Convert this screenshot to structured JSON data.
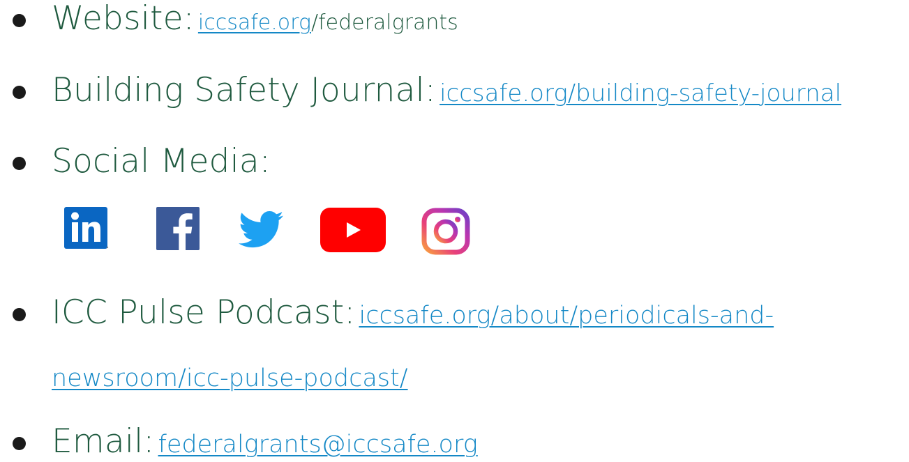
{
  "items": [
    {
      "label": "Website:",
      "link_part": "iccsafe.org",
      "plain_part": "/federalgrants"
    },
    {
      "label": "Building Safety Journal:",
      "link": "iccsafe.org/building-safety-journal"
    },
    {
      "label": "Social Media:"
    },
    {
      "label": "ICC Pulse Podcast:",
      "link_line1": "iccsafe.org/about/periodicals-and-",
      "link_line2": "newsroom/icc-pulse-podcast/"
    },
    {
      "label": "Email:",
      "link": "federalgrants@iccsafe.org"
    }
  ],
  "social_icons": [
    "linkedin-icon",
    "facebook-icon",
    "twitter-icon",
    "youtube-icon",
    "instagram-icon"
  ],
  "colors": {
    "text": "#1f5a3f",
    "link": "#1488c6",
    "bullet": "#1a1a1a",
    "linkedin": "#0a66c2",
    "facebook": "#3b5998",
    "twitter": "#1da1f2",
    "youtube": "#ff0000"
  }
}
